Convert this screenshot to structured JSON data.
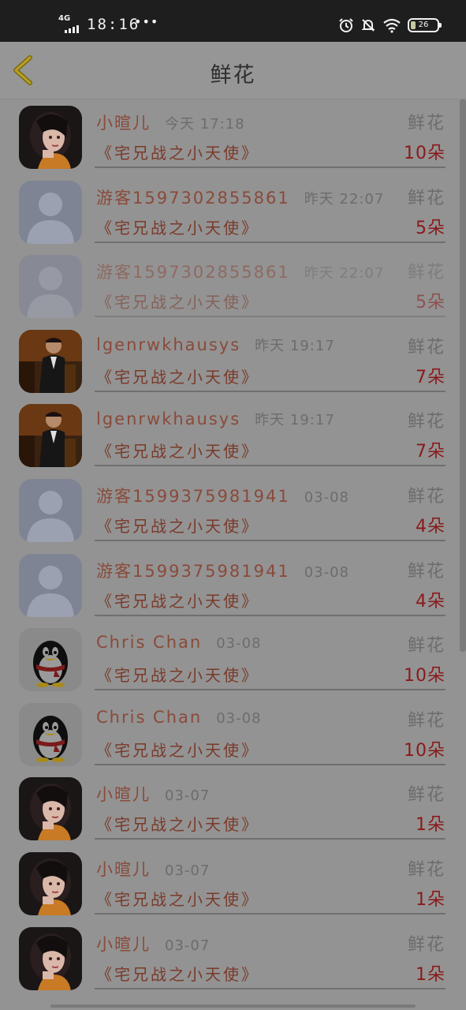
{
  "status_bar": {
    "network": "4G",
    "time": "18:16",
    "dots": "•••",
    "battery": "26"
  },
  "header": {
    "title": "鲜花",
    "back_icon": "chevron-left-icon"
  },
  "colors": {
    "name": "#8a4a3a",
    "book": "#7a3a2a",
    "count": "#8a1a1a",
    "meta": "#6c6c6c"
  },
  "rows": [
    {
      "avatar": "girl",
      "name": "小暄儿",
      "time": "今天 17:18",
      "gift": "鲜花",
      "book": "《宅兄战之小天使》",
      "count": "10朵",
      "faded": false
    },
    {
      "avatar": "default",
      "name": "游客1597302855861",
      "time": "昨天 22:07",
      "gift": "鲜花",
      "book": "《宅兄战之小天使》",
      "count": "5朵",
      "faded": false
    },
    {
      "avatar": "default",
      "name": "游客1597302855861",
      "time": "昨天 22:07",
      "gift": "鲜花",
      "book": "《宅兄战之小天使》",
      "count": "5朵",
      "faded": true
    },
    {
      "avatar": "man",
      "name": "lgenrwkhausys",
      "time": "昨天 19:17",
      "gift": "鲜花",
      "book": "《宅兄战之小天使》",
      "count": "7朵",
      "faded": false
    },
    {
      "avatar": "man",
      "name": "lgenrwkhausys",
      "time": "昨天 19:17",
      "gift": "鲜花",
      "book": "《宅兄战之小天使》",
      "count": "7朵",
      "faded": false
    },
    {
      "avatar": "default",
      "name": "游客1599375981941",
      "time": "03-08",
      "gift": "鲜花",
      "book": "《宅兄战之小天使》",
      "count": "4朵",
      "faded": false
    },
    {
      "avatar": "default",
      "name": "游客1599375981941",
      "time": "03-08",
      "gift": "鲜花",
      "book": "《宅兄战之小天使》",
      "count": "4朵",
      "faded": false
    },
    {
      "avatar": "penguin",
      "name": "Chris Chan",
      "time": "03-08",
      "gift": "鲜花",
      "book": "《宅兄战之小天使》",
      "count": "10朵",
      "faded": false
    },
    {
      "avatar": "penguin",
      "name": "Chris Chan",
      "time": "03-08",
      "gift": "鲜花",
      "book": "《宅兄战之小天使》",
      "count": "10朵",
      "faded": false
    },
    {
      "avatar": "girl",
      "name": "小暄儿",
      "time": "03-07",
      "gift": "鲜花",
      "book": "《宅兄战之小天使》",
      "count": "1朵",
      "faded": false
    },
    {
      "avatar": "girl",
      "name": "小暄儿",
      "time": "03-07",
      "gift": "鲜花",
      "book": "《宅兄战之小天使》",
      "count": "1朵",
      "faded": false
    },
    {
      "avatar": "girl",
      "name": "小暄儿",
      "time": "03-07",
      "gift": "鲜花",
      "book": "《宅兄战之小天使》",
      "count": "1朵",
      "faded": false
    }
  ]
}
